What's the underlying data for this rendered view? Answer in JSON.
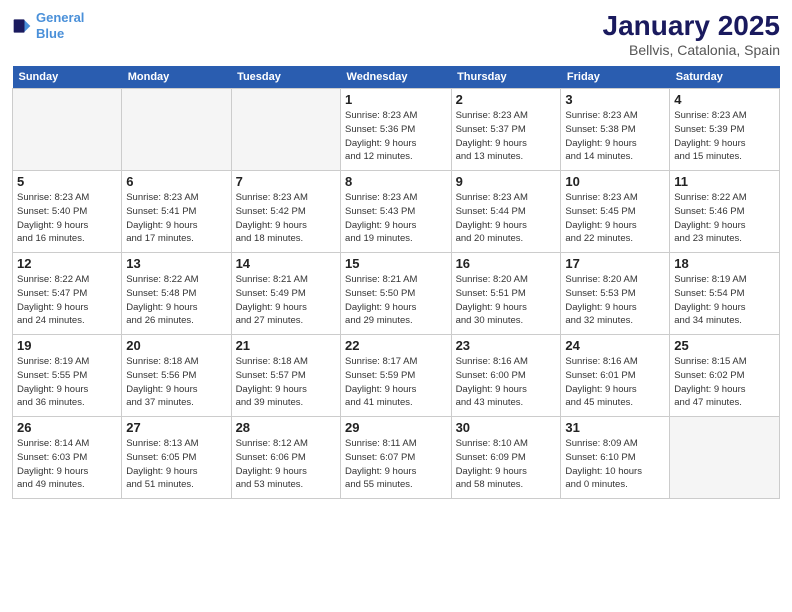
{
  "logo": {
    "line1": "General",
    "line2": "Blue"
  },
  "title": "January 2025",
  "location": "Bellvis, Catalonia, Spain",
  "weekdays": [
    "Sunday",
    "Monday",
    "Tuesday",
    "Wednesday",
    "Thursday",
    "Friday",
    "Saturday"
  ],
  "weeks": [
    [
      {
        "day": "",
        "info": ""
      },
      {
        "day": "",
        "info": ""
      },
      {
        "day": "",
        "info": ""
      },
      {
        "day": "1",
        "info": "Sunrise: 8:23 AM\nSunset: 5:36 PM\nDaylight: 9 hours\nand 12 minutes."
      },
      {
        "day": "2",
        "info": "Sunrise: 8:23 AM\nSunset: 5:37 PM\nDaylight: 9 hours\nand 13 minutes."
      },
      {
        "day": "3",
        "info": "Sunrise: 8:23 AM\nSunset: 5:38 PM\nDaylight: 9 hours\nand 14 minutes."
      },
      {
        "day": "4",
        "info": "Sunrise: 8:23 AM\nSunset: 5:39 PM\nDaylight: 9 hours\nand 15 minutes."
      }
    ],
    [
      {
        "day": "5",
        "info": "Sunrise: 8:23 AM\nSunset: 5:40 PM\nDaylight: 9 hours\nand 16 minutes."
      },
      {
        "day": "6",
        "info": "Sunrise: 8:23 AM\nSunset: 5:41 PM\nDaylight: 9 hours\nand 17 minutes."
      },
      {
        "day": "7",
        "info": "Sunrise: 8:23 AM\nSunset: 5:42 PM\nDaylight: 9 hours\nand 18 minutes."
      },
      {
        "day": "8",
        "info": "Sunrise: 8:23 AM\nSunset: 5:43 PM\nDaylight: 9 hours\nand 19 minutes."
      },
      {
        "day": "9",
        "info": "Sunrise: 8:23 AM\nSunset: 5:44 PM\nDaylight: 9 hours\nand 20 minutes."
      },
      {
        "day": "10",
        "info": "Sunrise: 8:23 AM\nSunset: 5:45 PM\nDaylight: 9 hours\nand 22 minutes."
      },
      {
        "day": "11",
        "info": "Sunrise: 8:22 AM\nSunset: 5:46 PM\nDaylight: 9 hours\nand 23 minutes."
      }
    ],
    [
      {
        "day": "12",
        "info": "Sunrise: 8:22 AM\nSunset: 5:47 PM\nDaylight: 9 hours\nand 24 minutes."
      },
      {
        "day": "13",
        "info": "Sunrise: 8:22 AM\nSunset: 5:48 PM\nDaylight: 9 hours\nand 26 minutes."
      },
      {
        "day": "14",
        "info": "Sunrise: 8:21 AM\nSunset: 5:49 PM\nDaylight: 9 hours\nand 27 minutes."
      },
      {
        "day": "15",
        "info": "Sunrise: 8:21 AM\nSunset: 5:50 PM\nDaylight: 9 hours\nand 29 minutes."
      },
      {
        "day": "16",
        "info": "Sunrise: 8:20 AM\nSunset: 5:51 PM\nDaylight: 9 hours\nand 30 minutes."
      },
      {
        "day": "17",
        "info": "Sunrise: 8:20 AM\nSunset: 5:53 PM\nDaylight: 9 hours\nand 32 minutes."
      },
      {
        "day": "18",
        "info": "Sunrise: 8:19 AM\nSunset: 5:54 PM\nDaylight: 9 hours\nand 34 minutes."
      }
    ],
    [
      {
        "day": "19",
        "info": "Sunrise: 8:19 AM\nSunset: 5:55 PM\nDaylight: 9 hours\nand 36 minutes."
      },
      {
        "day": "20",
        "info": "Sunrise: 8:18 AM\nSunset: 5:56 PM\nDaylight: 9 hours\nand 37 minutes."
      },
      {
        "day": "21",
        "info": "Sunrise: 8:18 AM\nSunset: 5:57 PM\nDaylight: 9 hours\nand 39 minutes."
      },
      {
        "day": "22",
        "info": "Sunrise: 8:17 AM\nSunset: 5:59 PM\nDaylight: 9 hours\nand 41 minutes."
      },
      {
        "day": "23",
        "info": "Sunrise: 8:16 AM\nSunset: 6:00 PM\nDaylight: 9 hours\nand 43 minutes."
      },
      {
        "day": "24",
        "info": "Sunrise: 8:16 AM\nSunset: 6:01 PM\nDaylight: 9 hours\nand 45 minutes."
      },
      {
        "day": "25",
        "info": "Sunrise: 8:15 AM\nSunset: 6:02 PM\nDaylight: 9 hours\nand 47 minutes."
      }
    ],
    [
      {
        "day": "26",
        "info": "Sunrise: 8:14 AM\nSunset: 6:03 PM\nDaylight: 9 hours\nand 49 minutes."
      },
      {
        "day": "27",
        "info": "Sunrise: 8:13 AM\nSunset: 6:05 PM\nDaylight: 9 hours\nand 51 minutes."
      },
      {
        "day": "28",
        "info": "Sunrise: 8:12 AM\nSunset: 6:06 PM\nDaylight: 9 hours\nand 53 minutes."
      },
      {
        "day": "29",
        "info": "Sunrise: 8:11 AM\nSunset: 6:07 PM\nDaylight: 9 hours\nand 55 minutes."
      },
      {
        "day": "30",
        "info": "Sunrise: 8:10 AM\nSunset: 6:09 PM\nDaylight: 9 hours\nand 58 minutes."
      },
      {
        "day": "31",
        "info": "Sunrise: 8:09 AM\nSunset: 6:10 PM\nDaylight: 10 hours\nand 0 minutes."
      },
      {
        "day": "",
        "info": ""
      }
    ]
  ]
}
